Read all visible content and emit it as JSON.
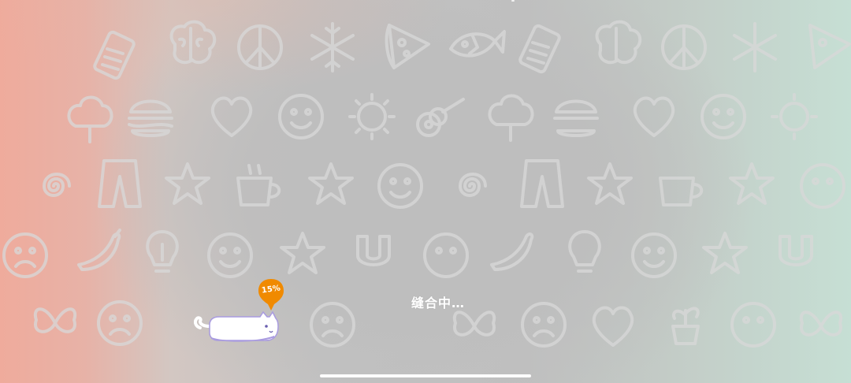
{
  "loading": {
    "status_text": "缝合中…",
    "progress_percent_label": "15%",
    "progress": 0.15
  },
  "colors": {
    "badge": "#f08a00",
    "cat_body": "#ffffff",
    "cat_belly": "#a99be0",
    "doodle": "#d5d5d5",
    "home_indicator": "#ffffff"
  },
  "background": {
    "pattern_icons": [
      "battery-icon",
      "brain-icon",
      "peace-icon",
      "snowflake-icon",
      "pizza-icon",
      "fish-icon",
      "burger-icon",
      "heart-icon",
      "smiley-icon",
      "sun-icon",
      "guitar-icon",
      "tree-icon",
      "pants-icon",
      "star-icon",
      "cup-icon",
      "spiral-icon",
      "chili-icon",
      "lightbulb-icon",
      "magnet-icon",
      "sad-face-icon",
      "butterfly-icon",
      "potted-plant-icon"
    ]
  }
}
